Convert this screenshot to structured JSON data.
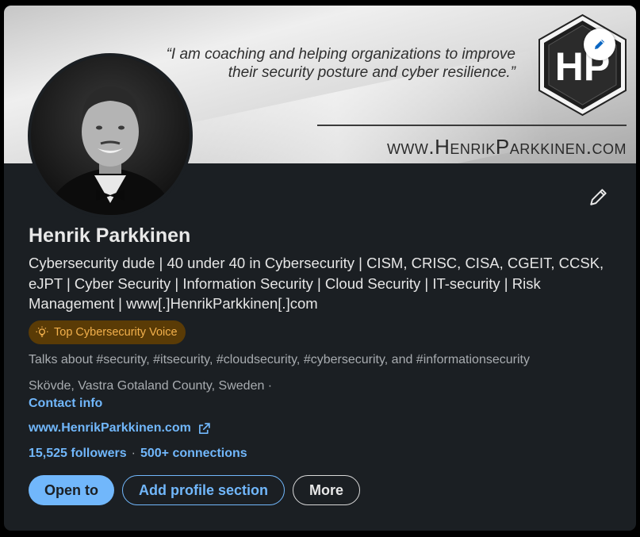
{
  "banner": {
    "quote_line1": "“I am coaching and helping organizations to improve",
    "quote_line2": "their security posture and cyber resilience.”",
    "url": "www.HenrikParkkinen.com",
    "logo_text": "HP"
  },
  "profile": {
    "name": "Henrik Parkkinen",
    "headline": "Cybersecurity dude | 40 under 40 in Cybersecurity | CISM, CRISC, CISA, CGEIT, CCSK, eJPT | Cyber Security | Information Security | Cloud Security | IT-security | Risk Management | www[.]HenrikParkkinen[.]com",
    "badge": "Top Cybersecurity Voice",
    "talks_about": "Talks about #security, #itsecurity, #cloudsecurity, #cybersecurity, and #informationsecurity",
    "location": "Skövde, Vastra Gotaland County, Sweden ·",
    "contact_info": "Contact info",
    "website": "www.HenrikParkkinen.com",
    "followers": "15,525 followers",
    "separator": "·",
    "connections": "500+ connections"
  },
  "actions": {
    "open_to": "Open to",
    "add_section": "Add profile section",
    "more": "More"
  },
  "icons": {
    "banner_edit": "pencil-icon",
    "intro_edit": "pencil-icon",
    "badge": "lightbulb-icon",
    "external": "external-link-icon"
  },
  "colors": {
    "card_bg": "#1b1f23",
    "link": "#71b7fb",
    "badge_bg": "#5a3b06",
    "badge_text": "#f2b04c"
  }
}
